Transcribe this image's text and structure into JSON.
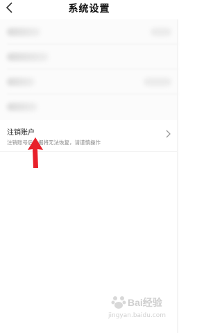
{
  "header": {
    "title": "系统设置",
    "back_icon": "chevron-left-icon"
  },
  "cancel_account": {
    "title": "注销账户",
    "subtitle": "注销账号后数据将无法恢复，请谨慎操作",
    "chevron_icon": "chevron-right-icon"
  },
  "annotation": {
    "arrow_color": "#e8202a"
  },
  "watermark": {
    "logo_text": "Bai",
    "logo_text_2": "经验",
    "url": "jingyan.baidu.com"
  }
}
